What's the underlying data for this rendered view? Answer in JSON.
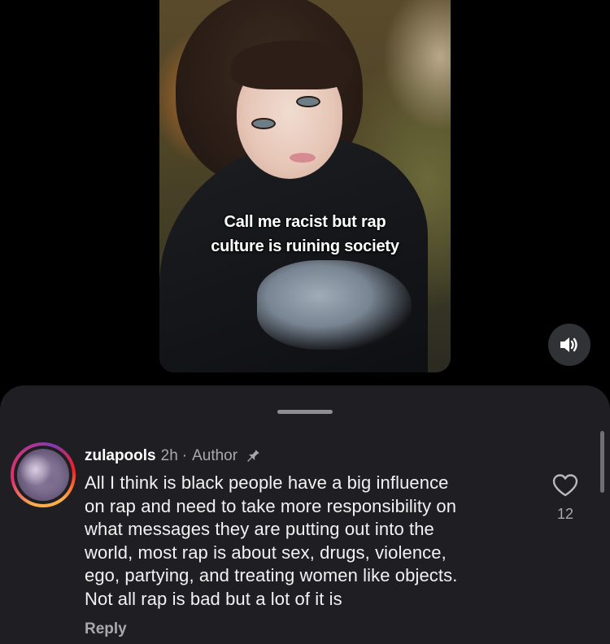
{
  "video": {
    "caption_lines": [
      "Call me racist but rap",
      "culture is ruining society"
    ],
    "sound_icon": "speaker-on-icon"
  },
  "comment": {
    "username": "zulapools",
    "time": "2h",
    "separator": "·",
    "author_label": "Author",
    "pin_icon": "pin-icon",
    "text": "All I think is black people have a big influence\non rap and need to take more responsibility on\nwhat messages they are putting out into the\nworld, most rap is about sex, drugs, violence,\nego, partying, and treating women like objects.\nNot all rap is bad but a lot of it is",
    "reply_label": "Reply",
    "like_count": "12",
    "like_icon": "heart-icon"
  },
  "colors": {
    "sheet_background": "#1f1f23",
    "muted_text": "#a8a8ad",
    "primary_text": "#ffffff"
  }
}
